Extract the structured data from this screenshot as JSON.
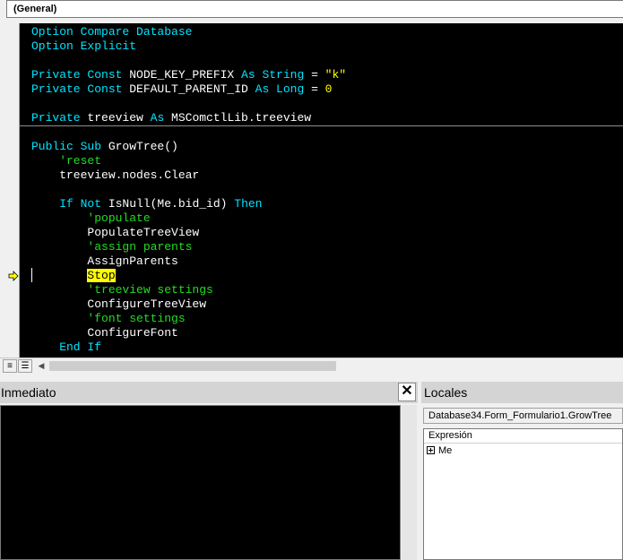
{
  "code_window": {
    "object_combo": "(General)",
    "lines": [
      [
        {
          "t": "kw",
          "v": "Option Compare Database"
        }
      ],
      [
        {
          "t": "kw",
          "v": "Option Explicit"
        }
      ],
      [],
      [
        {
          "t": "kw",
          "v": "Private Const "
        },
        {
          "t": "plain",
          "v": "NODE_KEY_PREFIX "
        },
        {
          "t": "kw",
          "v": "As String"
        },
        {
          "t": "plain",
          "v": " = "
        },
        {
          "t": "str",
          "v": "\"k\""
        }
      ],
      [
        {
          "t": "kw",
          "v": "Private Const "
        },
        {
          "t": "plain",
          "v": "DEFAULT_PARENT_ID "
        },
        {
          "t": "kw",
          "v": "As Long"
        },
        {
          "t": "plain",
          "v": " = "
        },
        {
          "t": "num",
          "v": "0"
        }
      ],
      [],
      [
        {
          "t": "kw",
          "v": "Private "
        },
        {
          "t": "plain",
          "v": "treeview "
        },
        {
          "t": "kw",
          "v": "As "
        },
        {
          "t": "plain",
          "v": "MSComctlLib.treeview"
        }
      ],
      [],
      [
        {
          "t": "kw",
          "v": "Public Sub "
        },
        {
          "t": "plain",
          "v": "GrowTree()"
        }
      ],
      [
        {
          "t": "cmt",
          "v": "    'reset"
        }
      ],
      [
        {
          "t": "plain",
          "v": "    treeview.nodes.Clear"
        }
      ],
      [],
      [
        {
          "t": "kw",
          "v": "    If Not "
        },
        {
          "t": "plain",
          "v": "IsNull(Me.bid_id) "
        },
        {
          "t": "kw",
          "v": "Then"
        }
      ],
      [
        {
          "t": "cmt",
          "v": "        'populate"
        }
      ],
      [
        {
          "t": "plain",
          "v": "        PopulateTreeView"
        }
      ],
      [
        {
          "t": "cmt",
          "v": "        'assign parents"
        }
      ],
      [
        {
          "t": "plain",
          "v": "        AssignParents"
        }
      ],
      [
        {
          "t": "plain",
          "v": "        "
        },
        {
          "t": "stop",
          "v": "Stop"
        }
      ],
      [
        {
          "t": "cmt",
          "v": "        'treeview settings"
        }
      ],
      [
        {
          "t": "plain",
          "v": "        ConfigureTreeView"
        }
      ],
      [
        {
          "t": "cmt",
          "v": "        'font settings"
        }
      ],
      [
        {
          "t": "plain",
          "v": "        ConfigureFont"
        }
      ],
      [
        {
          "t": "kw",
          "v": "    End If"
        }
      ]
    ],
    "current_line_index": 17,
    "execution_arrow_icon": "execution-point-arrow-icon",
    "colors": {
      "background": "#000000",
      "keyword": "#00e5ff",
      "comment": "#22dd22",
      "string": "#ffff00",
      "highlight": "#ffff00"
    }
  },
  "bottom_bar": {
    "procedure_view_icon": "procedure-view-icon",
    "full_module_view_icon": "full-module-view-icon",
    "scroll_left_icon": "scroll-left-icon"
  },
  "immediate": {
    "title": "Inmediato",
    "close_glyph": "✕"
  },
  "locals": {
    "title": "Locales",
    "context": "Database34.Form_Formulario1.GrowTree",
    "column_header": "Expresión",
    "items": [
      {
        "name": "Me",
        "expandable": true
      }
    ]
  }
}
